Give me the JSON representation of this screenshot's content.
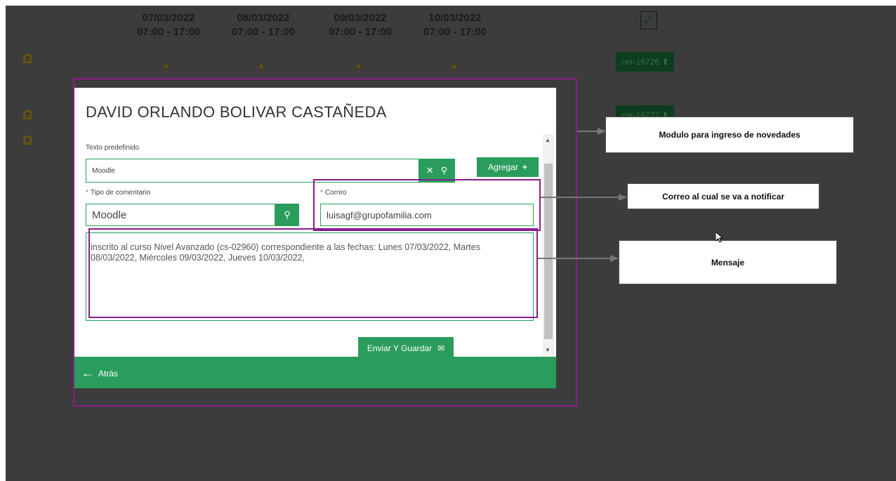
{
  "schedule": {
    "dates": [
      {
        "date": "07/03/2022",
        "time": "07:00 - 17:00"
      },
      {
        "date": "08/03/2022",
        "time": "07:00 - 17:00"
      },
      {
        "date": "09/03/2022",
        "time": "07:00 - 17:00"
      },
      {
        "date": "10/03/2022",
        "time": "07:00 - 17:00"
      }
    ],
    "certificates": [
      "cer-16726",
      "cer-16727"
    ]
  },
  "modal": {
    "title": "DAVID ORLANDO BOLIVAR CASTAÑEDA",
    "predefined_label": "Texto predefinido",
    "predefined_value": "Moodle",
    "add_label": "Agregar",
    "comment_type_label": "Tipo de comentario",
    "comment_type_value": "Moodle",
    "email_label": "Correo",
    "email_value": "luisagf@grupofamilia.com",
    "message": "inscrito al curso Nivel Avanzado (cs-02960) correspondiente a las fechas: Lunes 07/03/2022, Martes 08/03/2022, Miércoles 09/03/2022, Jueves 10/03/2022,",
    "send_label": "Enviar Y Guardar",
    "back_label": "Atrás"
  },
  "annotations": {
    "module": "Modulo para ingreso de novedades",
    "email": "Correo al cual se va a notificar",
    "message": "Mensaje"
  },
  "colors": {
    "accent": "#2a9d5c",
    "annotation": "#8b1c8c",
    "backdrop": "#3c3c3c"
  }
}
